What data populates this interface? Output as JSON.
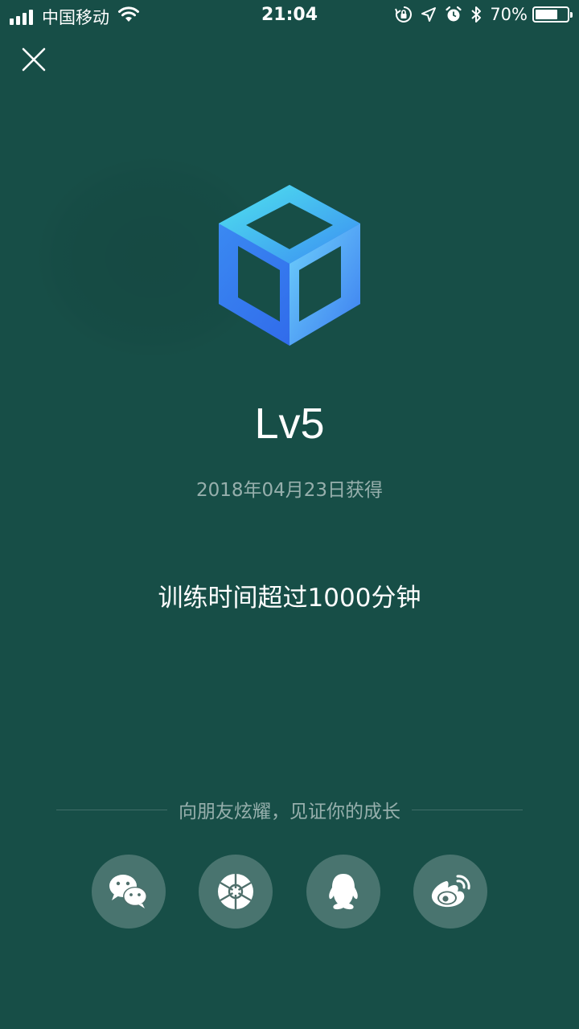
{
  "status_bar": {
    "carrier": "中国移动",
    "time": "21:04",
    "battery_percent": "70%",
    "battery_level": 0.7,
    "icons": [
      "signal-icon",
      "wifi-icon",
      "rotation-lock-icon",
      "location-icon",
      "alarm-icon",
      "bluetooth-icon",
      "battery-icon"
    ]
  },
  "header": {
    "close_icon": "close-icon"
  },
  "badge": {
    "icon": "cube-badge-icon",
    "level": "Lv5",
    "earned_date": "2018年04月23日获得",
    "description": "训练时间超过1000分钟"
  },
  "share": {
    "prompt": "向朋友炫耀，见证你的成长",
    "buttons": [
      {
        "icon": "wechat-icon"
      },
      {
        "icon": "moments-icon"
      },
      {
        "icon": "qq-icon"
      },
      {
        "icon": "weibo-icon"
      }
    ]
  },
  "colors": {
    "background": "#174e47",
    "badge_gradient_start": "#4fe3ee",
    "badge_gradient_end": "#2f6cf0",
    "share_button_bg": "rgba(255,255,255,0.22)"
  }
}
